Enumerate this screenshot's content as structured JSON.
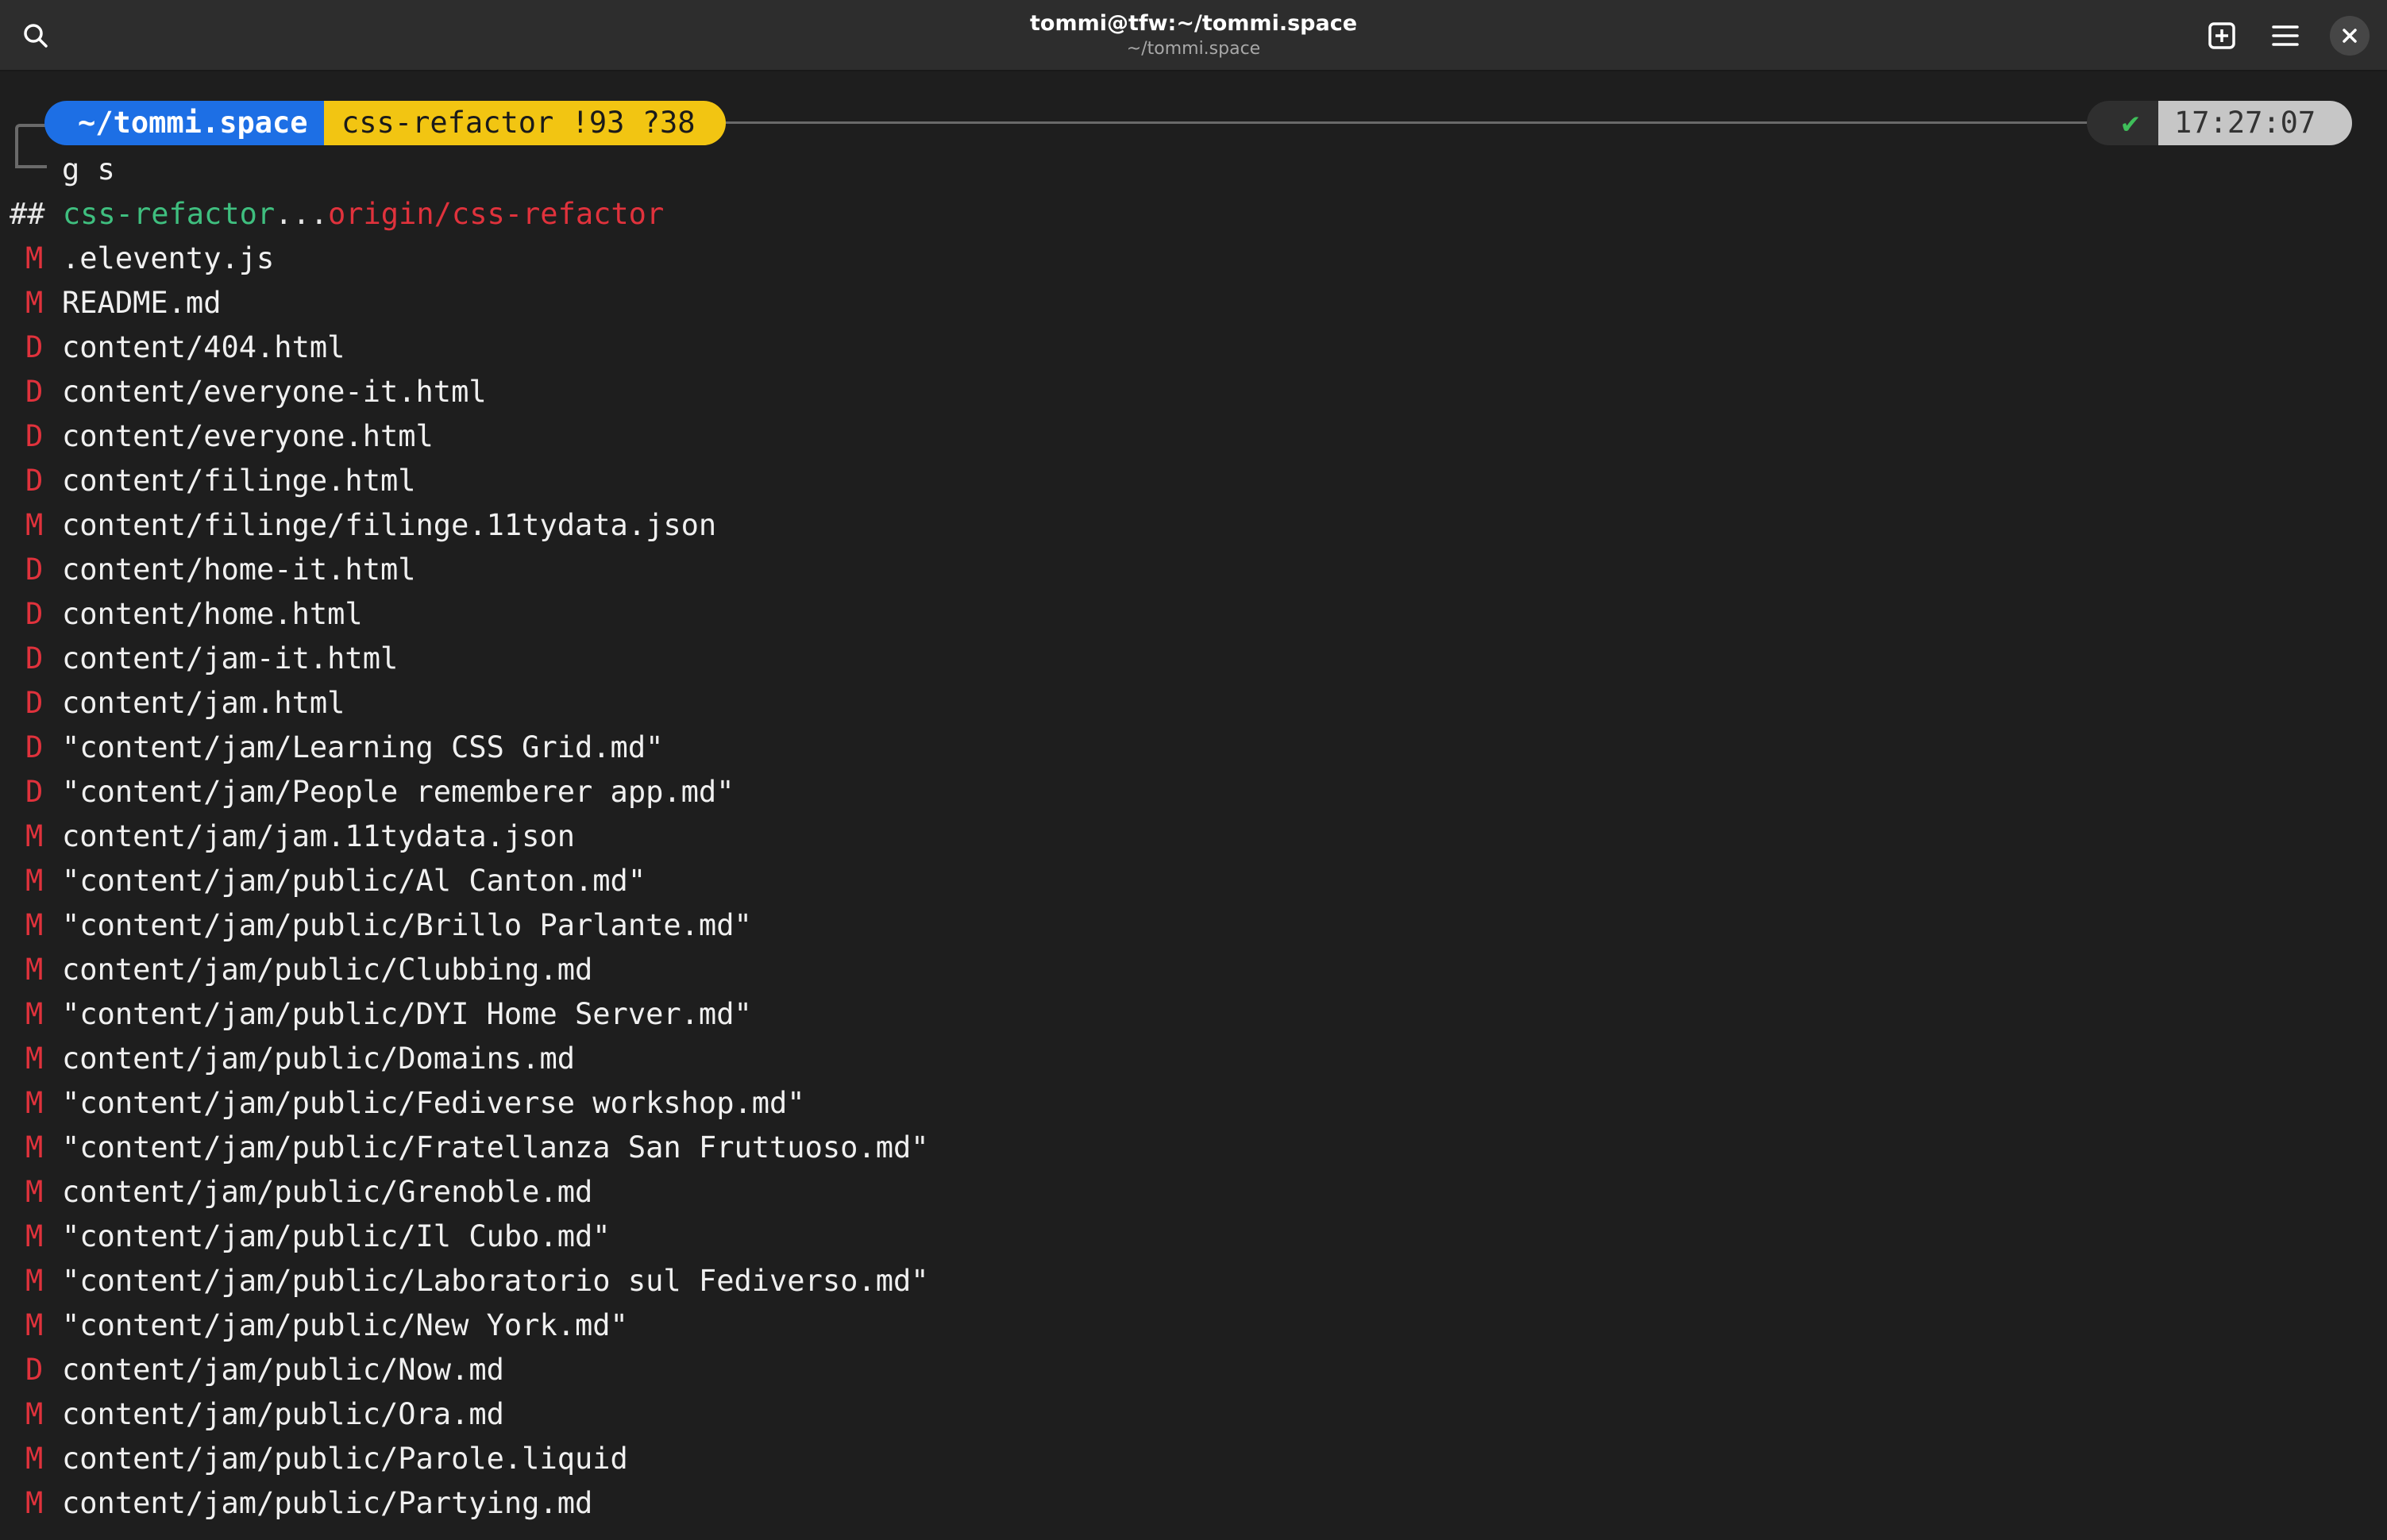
{
  "window": {
    "title": "tommi@tfw:~/tommi.space",
    "subtitle": "~/tommi.space",
    "icons": {
      "search": "search-icon",
      "new_tab": "new-tab-icon",
      "menu": "hamburger-menu-icon",
      "close": "close-icon"
    }
  },
  "prompt": {
    "directory": "~/tommi.space",
    "git": "css-refactor !93 ?38",
    "status": "✔",
    "time": "17:27:07"
  },
  "command": "g s",
  "branch": {
    "marker": "##",
    "local": "css-refactor",
    "separator": "...",
    "remote": "origin/css-refactor"
  },
  "colors": {
    "background": "#1e1e1e",
    "header": "#2d2d2d",
    "dir_segment": "#1d6fe5",
    "git_segment": "#f2c512",
    "time_segment": "#c6c6c6",
    "status_ok": "#3fbf5a",
    "branch_local": "#3fbf7f",
    "branch_remote": "#e0323c",
    "file_status": "#e0323c"
  },
  "files": [
    {
      "status": "M",
      "path": ".eleventy.js"
    },
    {
      "status": "M",
      "path": "README.md"
    },
    {
      "status": "D",
      "path": "content/404.html"
    },
    {
      "status": "D",
      "path": "content/everyone-it.html"
    },
    {
      "status": "D",
      "path": "content/everyone.html"
    },
    {
      "status": "D",
      "path": "content/filinge.html"
    },
    {
      "status": "M",
      "path": "content/filinge/filinge.11tydata.json"
    },
    {
      "status": "D",
      "path": "content/home-it.html"
    },
    {
      "status": "D",
      "path": "content/home.html"
    },
    {
      "status": "D",
      "path": "content/jam-it.html"
    },
    {
      "status": "D",
      "path": "content/jam.html"
    },
    {
      "status": "D",
      "path": "\"content/jam/Learning CSS Grid.md\""
    },
    {
      "status": "D",
      "path": "\"content/jam/People rememberer app.md\""
    },
    {
      "status": "M",
      "path": "content/jam/jam.11tydata.json"
    },
    {
      "status": "M",
      "path": "\"content/jam/public/Al Canton.md\""
    },
    {
      "status": "M",
      "path": "\"content/jam/public/Brillo Parlante.md\""
    },
    {
      "status": "M",
      "path": "content/jam/public/Clubbing.md"
    },
    {
      "status": "M",
      "path": "\"content/jam/public/DYI Home Server.md\""
    },
    {
      "status": "M",
      "path": "content/jam/public/Domains.md"
    },
    {
      "status": "M",
      "path": "\"content/jam/public/Fediverse workshop.md\""
    },
    {
      "status": "M",
      "path": "\"content/jam/public/Fratellanza San Fruttuoso.md\""
    },
    {
      "status": "M",
      "path": "content/jam/public/Grenoble.md"
    },
    {
      "status": "M",
      "path": "\"content/jam/public/Il Cubo.md\""
    },
    {
      "status": "M",
      "path": "\"content/jam/public/Laboratorio sul Fediverso.md\""
    },
    {
      "status": "M",
      "path": "\"content/jam/public/New York.md\""
    },
    {
      "status": "D",
      "path": "content/jam/public/Now.md"
    },
    {
      "status": "M",
      "path": "content/jam/public/Ora.md"
    },
    {
      "status": "M",
      "path": "content/jam/public/Parole.liquid"
    },
    {
      "status": "M",
      "path": "content/jam/public/Partying.md"
    }
  ]
}
